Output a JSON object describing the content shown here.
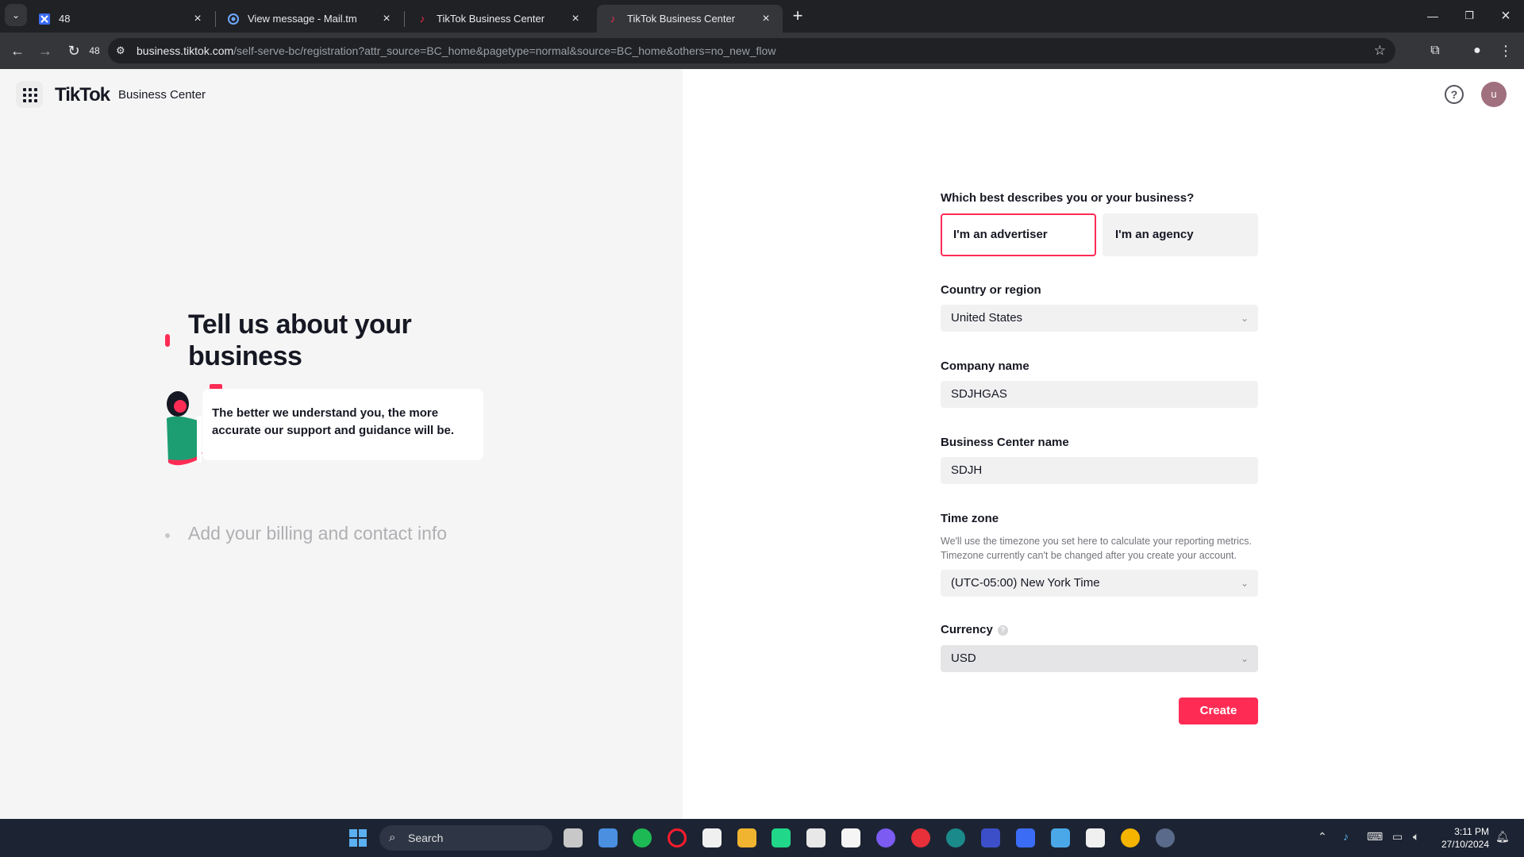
{
  "browser": {
    "tabs": [
      {
        "title": "48"
      },
      {
        "title": "View message - Mail.tm"
      },
      {
        "title": "TikTok Business Center"
      },
      {
        "title": "TikTok Business Center"
      }
    ],
    "reload_count": "48",
    "url_host": "business.tiktok.com",
    "url_path": "/self-serve-bc/registration?attr_source=BC_home&pagetype=normal&source=BC_home&others=no_new_flow"
  },
  "header": {
    "logo": "TikTok",
    "logo_sub": "Business Center",
    "help": "?",
    "avatar_initial": "u"
  },
  "left": {
    "step1_title": "Tell us about your business",
    "speech": "The better we understand you, the more accurate our support and guidance will be.",
    "step2_title": "Add your billing and contact info"
  },
  "form": {
    "question": "Which best describes you or your business?",
    "choice_advertiser": "I'm an advertiser",
    "choice_agency": "I'm an agency",
    "country_label": "Country or region",
    "country_value": "United States",
    "company_label": "Company name",
    "company_value": "SDJHGAS",
    "bc_label": "Business Center name",
    "bc_value": "SDJH",
    "tz_label": "Time zone",
    "tz_hint": "We'll use the timezone you set here to calculate your reporting metrics. Timezone currently can't be changed after you create your account.",
    "tz_value": "(UTC-05:00) New York Time",
    "currency_label": "Currency",
    "currency_value": "USD",
    "create": "Create"
  },
  "taskbar": {
    "search": "Search",
    "time": "3:11 PM",
    "date": "27/10/2024"
  },
  "colors": {
    "accent": "#fe2c55"
  }
}
